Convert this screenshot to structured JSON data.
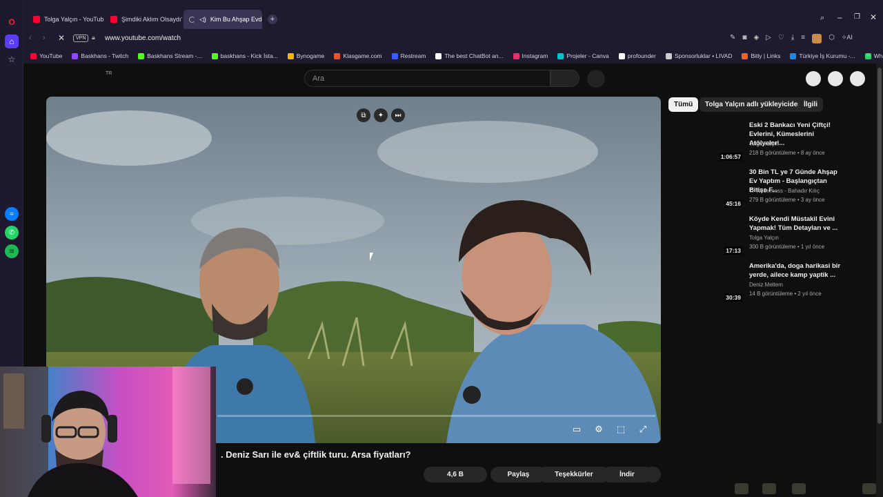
{
  "browser": {
    "tabs": [
      {
        "label": "Tolga Yalçın - YouTube"
      },
      {
        "label": "Şimdiki Aklım Olsaydı? Us"
      },
      {
        "label": "Kim Bu Ahşap Evde Ya"
      }
    ],
    "address": {
      "vpn": "VPN",
      "url": "www.youtube.com/watch"
    },
    "ai_label": "AI",
    "bookmarks": [
      {
        "label": "YouTube",
        "color": "#ff0033"
      },
      {
        "label": "Baskhans - Twitch",
        "color": "#9146ff"
      },
      {
        "label": "Baskhans Stream -...",
        "color": "#53fc18"
      },
      {
        "label": "baskhans - Kick İsta...",
        "color": "#53fc18"
      },
      {
        "label": "Bynogame",
        "color": "#f5b400"
      },
      {
        "label": "Klasgame.com",
        "color": "#e8542a"
      },
      {
        "label": "Restream",
        "color": "#3a5bff"
      },
      {
        "label": "The best ChatBot an...",
        "color": "#ffffff"
      },
      {
        "label": "Instagram",
        "color": "#e1306c"
      },
      {
        "label": "Projeler - Canva",
        "color": "#00c4cc"
      },
      {
        "label": "profounder",
        "color": "#ffffff"
      },
      {
        "label": "Sponsorluklar • LIVAD",
        "color": "#cccccc"
      },
      {
        "label": "Bitly | Links",
        "color": "#ee6123"
      },
      {
        "label": "Türkiye İş Kurumu -...",
        "color": "#1e88e5"
      },
      {
        "label": "WhatsApp",
        "color": "#25d366"
      }
    ]
  },
  "youtube": {
    "country": "TR",
    "search_placeholder": "Ara",
    "video": {
      "title": ". Deniz Sarı ile ev& çiftlik turu. Arsa fiyatları?",
      "progress": 0.0
    },
    "actions": {
      "likes": "4,6 B",
      "share": "Paylaş",
      "thanks": "Teşekkürler",
      "download": "İndir"
    },
    "chips": [
      "Tümü",
      "Tolga Yalçın adlı yükleyiciden",
      "İlgili"
    ],
    "related": [
      {
        "title": "Eski 2 Bankacı Yeni Çiftçi! Evlerini, Kümeslerini Atölyeleri...",
        "channel": "Tolga Yalçın",
        "meta": "218 B görüntüleme • 8 ay önce",
        "duration": "1:06:57"
      },
      {
        "title": "30 Bin TL ye 7 Günde Ahşap Ev Yaptım - Başlangıçtan Bitişe F...",
        "channel": "Tr Wilderness - Bahadır Kılıç",
        "meta": "279 B görüntüleme • 3 ay önce",
        "duration": "45:16"
      },
      {
        "title": "Köyde Kendi Müstakil Evini Yapmak! Tüm Detayları ve ...",
        "channel": "Tolga Yalçın",
        "meta": "300 B görüntüleme • 1 yıl önce",
        "duration": "17:13"
      },
      {
        "title": "Amerika'da, doga harikasi bir yerde, ailece kamp yaptik ...",
        "channel": "Deniz Meltem",
        "meta": "14 B görüntüleme • 2 yıl önce",
        "duration": "30:39"
      }
    ]
  }
}
